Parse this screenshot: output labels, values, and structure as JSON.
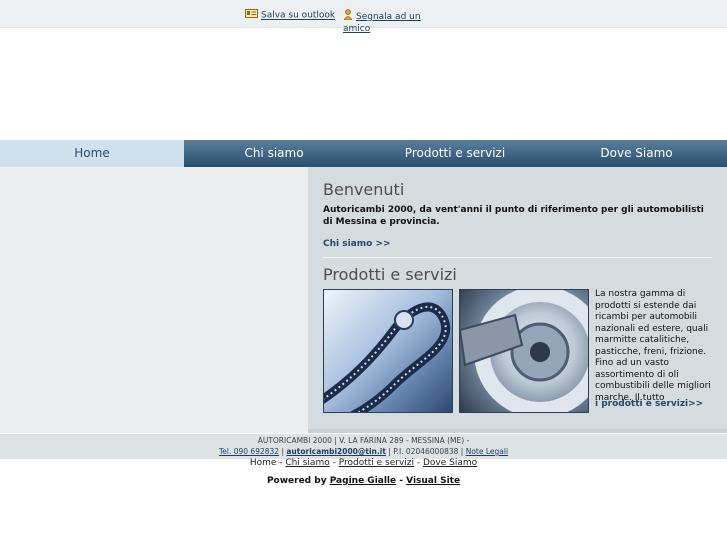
{
  "top": {
    "outlook_link": "Salva su outlook",
    "friend_link": "Segnala ad un amico"
  },
  "nav": {
    "tabs": [
      {
        "label": "Home"
      },
      {
        "label": "Chi siamo"
      },
      {
        "label": "Prodotti e servizi"
      },
      {
        "label": "Dove Siamo"
      }
    ]
  },
  "welcome": {
    "title": "Benvenuti",
    "text": "Autoricambi 2000, da vent'anni il punto di riferimento per gli automobilisti di Messina e provincia.",
    "more": "Chi siamo >>"
  },
  "products": {
    "title": "Prodotti e servizi",
    "text": "La nostra gamma di prodotti si estende dai ricambi per automobili nazionali ed estere, quali marmitte catalitiche, pasticche, freni, frizione. Fino ad un vasto assortimento di oli combustibili delle migliori marche. Il tutto",
    "more": "i prodotti e servizi>>"
  },
  "footer": {
    "address": "AUTORICAMBI 2000 | V. LA FARINA 289 - MESSINA (ME) -",
    "tel": "Tel. 090 692832",
    "sep1": " | ",
    "email": "autoricambi2000@tin.it",
    "piva": " | P.I. 02046000838 | ",
    "legal": "Note Legali"
  },
  "footer_nav": {
    "home": "Home",
    "sep": "  - ",
    "chi": "Chi siamo",
    "prodotti": "Prodotti e servizi",
    "dove": "Dove Siamo"
  },
  "powered": {
    "label": "Powered by ",
    "pagine": "Pagine Gialle",
    "dash": " - ",
    "visual": "Visual Site"
  }
}
